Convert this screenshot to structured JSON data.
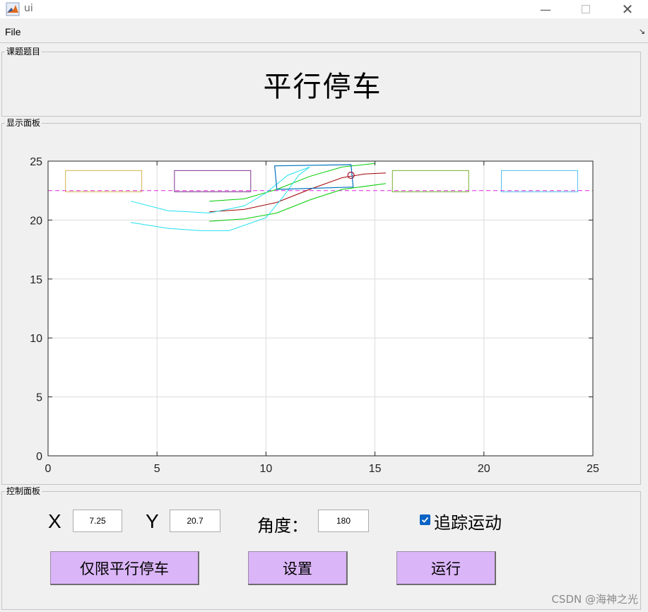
{
  "window": {
    "title": "ui",
    "icon": "matlab-icon",
    "controls": [
      "minimize-icon",
      "maximize-icon",
      "close-icon"
    ]
  },
  "menu": {
    "file_label": "File"
  },
  "topic_panel": {
    "label": "课题题目",
    "title": "平行停车"
  },
  "display_panel": {
    "label": "显示面板"
  },
  "control_panel": {
    "label": "控制面板",
    "x_label": "X",
    "x_value": "7.25",
    "y_label": "Y",
    "y_value": "20.7",
    "angle_label": "角度：",
    "angle_value": "180",
    "track_label": "追踪运动",
    "track_checked": true,
    "btn_parallel": "仅限平行停车",
    "btn_settings": "设置",
    "btn_run": "运行"
  },
  "watermark": "CSDN @海神之光",
  "colors": {
    "button_bg": "#dab5f7",
    "checkbox": "#0b63c5"
  },
  "chart_data": {
    "type": "line",
    "xlim": [
      0,
      25
    ],
    "ylim": [
      0,
      25
    ],
    "xticks": [
      "0",
      "5",
      "10",
      "15",
      "20",
      "25"
    ],
    "yticks": [
      "0",
      "5",
      "10",
      "15",
      "20",
      "25"
    ],
    "grid": true,
    "reference_line": {
      "y": 22.5,
      "color": "#e040e0",
      "style": "dashed"
    },
    "parked_cars": [
      {
        "x": [
          0.8,
          4.3
        ],
        "y": [
          22.4,
          24.2
        ],
        "color": "#d4b24a"
      },
      {
        "x": [
          5.8,
          9.3
        ],
        "y": [
          22.4,
          24.2
        ],
        "color": "#7e2f8e"
      },
      {
        "x": [
          15.8,
          19.3
        ],
        "y": [
          22.4,
          24.2
        ],
        "color": "#77ac30"
      },
      {
        "x": [
          20.8,
          24.3
        ],
        "y": [
          22.4,
          24.2
        ],
        "color": "#4dbeee"
      }
    ],
    "vehicle": {
      "corners": [
        [
          10.4,
          24.6
        ],
        [
          13.9,
          24.7
        ],
        [
          14.0,
          22.8
        ],
        [
          10.5,
          22.6
        ]
      ],
      "color": "#0072bd",
      "marker": {
        "x": 13.9,
        "y": 23.8,
        "color": "#a2142f"
      }
    },
    "series": [
      {
        "color": "#a00000",
        "points": [
          [
            7.4,
            20.7
          ],
          [
            9.0,
            20.9
          ],
          [
            10.5,
            21.5
          ],
          [
            12.0,
            22.6
          ],
          [
            13.5,
            23.6
          ],
          [
            14.5,
            23.9
          ],
          [
            15.5,
            24.0
          ]
        ]
      },
      {
        "color": "#00cc00",
        "points": [
          [
            7.4,
            21.6
          ],
          [
            9.0,
            21.8
          ],
          [
            10.5,
            22.6
          ],
          [
            12.0,
            23.7
          ],
          [
            13.5,
            24.5
          ],
          [
            15.0,
            24.8
          ]
        ]
      },
      {
        "color": "#00cc00",
        "points": [
          [
            7.4,
            19.9
          ],
          [
            9.0,
            20.1
          ],
          [
            10.5,
            20.6
          ],
          [
            12.0,
            21.7
          ],
          [
            13.5,
            22.6
          ],
          [
            15.5,
            23.1
          ]
        ]
      },
      {
        "color": "#22e0f0",
        "points": [
          [
            3.8,
            21.6
          ],
          [
            5.5,
            20.8
          ],
          [
            7.4,
            20.6
          ],
          [
            9.0,
            21.2
          ],
          [
            10.0,
            22.3
          ],
          [
            11.0,
            23.8
          ],
          [
            12.0,
            24.5
          ]
        ]
      },
      {
        "color": "#22e0f0",
        "points": [
          [
            3.8,
            19.8
          ],
          [
            5.5,
            19.3
          ],
          [
            7.0,
            19.1
          ],
          [
            8.3,
            19.1
          ],
          [
            10.0,
            20.2
          ],
          [
            10.8,
            22.0
          ],
          [
            11.5,
            23.8
          ],
          [
            12.0,
            24.5
          ]
        ]
      }
    ]
  }
}
